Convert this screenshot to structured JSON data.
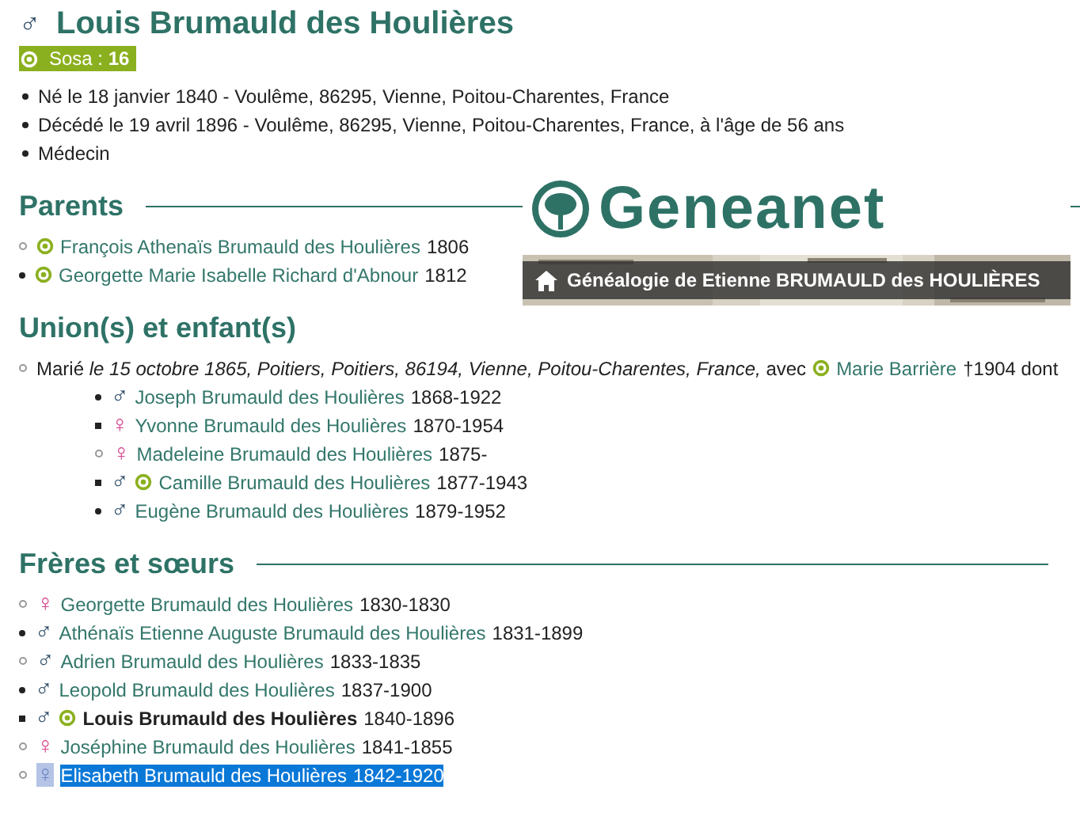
{
  "person": {
    "sex_symbol": "♂",
    "name": "Louis Brumauld des Houlières",
    "sosa_badge": "Sosa : **16**"
  },
  "facts": [
    "Né le 18 janvier 1840 - Voulême, 86295, Vienne, Poitou-Charentes, France",
    "Décédé le 19 avril 1896 - Voulême, 86295, Vienne, Poitou-Charentes, France, à l'âge de 56 ans",
    "Médecin"
  ],
  "banner": {
    "logo": "Geneanet",
    "title": "Généalogie de Etienne BRUMAULD des HOULIÈRES"
  },
  "parents": {
    "heading": "Parents",
    "items": [
      {
        "kind": "circle",
        "sosa": true,
        "name": "François Athenaïs Brumauld des Houlières",
        "dates": "1806"
      },
      {
        "kind": "disc",
        "sosa": true,
        "name": "Georgette Marie Isabelle Richard d'Abnour",
        "dates": "1812"
      }
    ]
  },
  "unions": {
    "heading": "Union(s) et enfant(s)",
    "marriage": {
      "kind": "circle",
      "text": "Marié *le 15 octobre 1865, Poitiers, Poitiers, 86194, Vienne, Poitou-Charentes, France,* avec",
      "spouse_sosa": true,
      "spouse": "Marie Barrière",
      "after": "†1904 dont"
    },
    "children": [
      {
        "kind": "disc",
        "sex_symbol": "♂",
        "color": "#2b4a66",
        "sosa": false,
        "name": "Joseph Brumauld des Houlières",
        "dates": "1868-1922"
      },
      {
        "kind": "square",
        "sex_symbol": "♀",
        "color": "#d9418c",
        "sosa": false,
        "name": "Yvonne Brumauld des Houlières",
        "dates": "1870-1954"
      },
      {
        "kind": "circle",
        "sex_symbol": "♀",
        "color": "#d9418c",
        "sosa": false,
        "name": "Madeleine Brumauld des Houlières",
        "dates": "1875-"
      },
      {
        "kind": "square",
        "sex_symbol": "♂",
        "color": "#2b4a66",
        "sosa": true,
        "name": "Camille Brumauld des Houlières",
        "dates": "1877-1943"
      },
      {
        "kind": "disc",
        "sex_symbol": "♂",
        "color": "#2b4a66",
        "sosa": false,
        "name": "Eugène Brumauld des Houlières",
        "dates": "1879-1952"
      }
    ]
  },
  "siblings": {
    "heading": "Frères et sœurs",
    "items": [
      {
        "kind": "circle",
        "sex_symbol": "♀",
        "color": "#d9418c",
        "sosa": false,
        "current": false,
        "selected": false,
        "name": "Georgette Brumauld des Houlières",
        "dates": "1830-1830"
      },
      {
        "kind": "disc",
        "sex_symbol": "♂",
        "color": "#2b4a66",
        "sosa": false,
        "current": false,
        "selected": false,
        "name": "Athénaïs Etienne Auguste Brumauld des Houlières",
        "dates": "1831-1899"
      },
      {
        "kind": "circle",
        "sex_symbol": "♂",
        "color": "#2b4a66",
        "sosa": false,
        "current": false,
        "selected": false,
        "name": "Adrien Brumauld des Houlières",
        "dates": "1833-1835"
      },
      {
        "kind": "disc",
        "sex_symbol": "♂",
        "color": "#2b4a66",
        "sosa": false,
        "current": false,
        "selected": false,
        "name": "Leopold Brumauld des Houlières",
        "dates": "1837-1900"
      },
      {
        "kind": "square",
        "sex_symbol": "♂",
        "color": "#2b4a66",
        "sosa": true,
        "current": true,
        "selected": false,
        "name": "Louis Brumauld des Houlières",
        "dates": "1840-1896"
      },
      {
        "kind": "circle",
        "sex_symbol": "♀",
        "color": "#d9418c",
        "sosa": false,
        "current": false,
        "selected": false,
        "name": "Joséphine Brumauld des Houlières",
        "dates": "1841-1855"
      },
      {
        "kind": "circle",
        "sex_symbol": "♀",
        "color": "#6f86c4",
        "sosa": false,
        "current": false,
        "selected": true,
        "name": "Elisabeth Brumauld des Houlières",
        "dates": "1842-1920"
      }
    ]
  }
}
